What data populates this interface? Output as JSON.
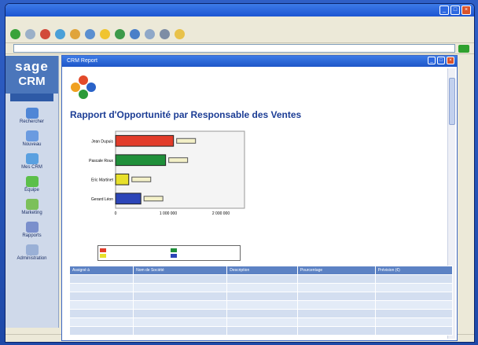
{
  "sidebar": {
    "logo_top": "sage",
    "logo_bottom": "CRM",
    "items": [
      {
        "label": "Rechercher",
        "icon": "magnifier-icon",
        "color": "#4f86d6"
      },
      {
        "label": "Nouveau",
        "icon": "new-document-icon",
        "color": "#6b9be0"
      },
      {
        "label": "Mes CRM",
        "icon": "home-icon",
        "color": "#5aa0e0"
      },
      {
        "label": "Équipe",
        "icon": "team-icon",
        "color": "#5cbf4a"
      },
      {
        "label": "Marketing",
        "icon": "marketing-icon",
        "color": "#7cc05a"
      },
      {
        "label": "Rapports",
        "icon": "reports-icon",
        "color": "#7a8fcc"
      },
      {
        "label": "Administration",
        "icon": "admin-icon",
        "color": "#9ab0d6"
      }
    ]
  },
  "report": {
    "window_title": "CRM Report",
    "heading": "Rapport d'Opportunité par Responsable des Ventes"
  },
  "chart_data": {
    "type": "bar",
    "orientation": "horizontal",
    "categories": [
      "Jean Dupuis",
      "Pascale Roux",
      "Eric Martinet",
      "Gerard Léon"
    ],
    "values": [
      1100000,
      950000,
      250000,
      480000
    ],
    "colors": [
      "#e23c2a",
      "#1f8f3a",
      "#e7e02b",
      "#2c45b8"
    ],
    "xlim": [
      0,
      2000000
    ],
    "xticks": [
      "0",
      "1 000 000",
      "2 000 000"
    ]
  },
  "table": {
    "columns": [
      "Assigné à",
      "Nom de Société",
      "Description",
      "Pourcentage",
      "Prévision (€)"
    ],
    "rows": [
      [
        "",
        "",
        "",
        "",
        ""
      ],
      [
        "",
        "",
        "",
        "",
        ""
      ],
      [
        "",
        "",
        "",
        "",
        ""
      ],
      [
        "",
        "",
        "",
        "",
        ""
      ],
      [
        "",
        "",
        "",
        "",
        ""
      ],
      [
        "",
        "",
        "",
        "",
        ""
      ],
      [
        "",
        "",
        "",
        "",
        ""
      ]
    ]
  }
}
